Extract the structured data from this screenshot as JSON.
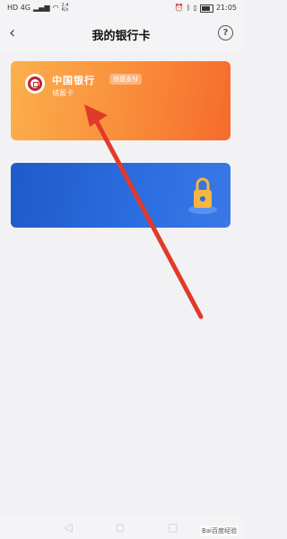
{
  "status_bar": {
    "network": "HD 4G",
    "speed": "2.4",
    "speed_unit": "K/s",
    "time": "21:05"
  },
  "header": {
    "title": "我的银行卡",
    "help_symbol": "?"
  },
  "bank_card": {
    "bank_name": "中国银行",
    "badge": "快捷支付",
    "card_type": "储蓄卡",
    "links": [
      "",
      "",
      "",
      ""
    ],
    "gradient_start": "#fbb04d",
    "gradient_end": "#f66a2c"
  },
  "promo_banner": {
    "title": "",
    "subtitle": "",
    "color": "#2c6ee0"
  },
  "annotation": {
    "color": "#e23a2a"
  },
  "watermark": "Bai百度经验"
}
